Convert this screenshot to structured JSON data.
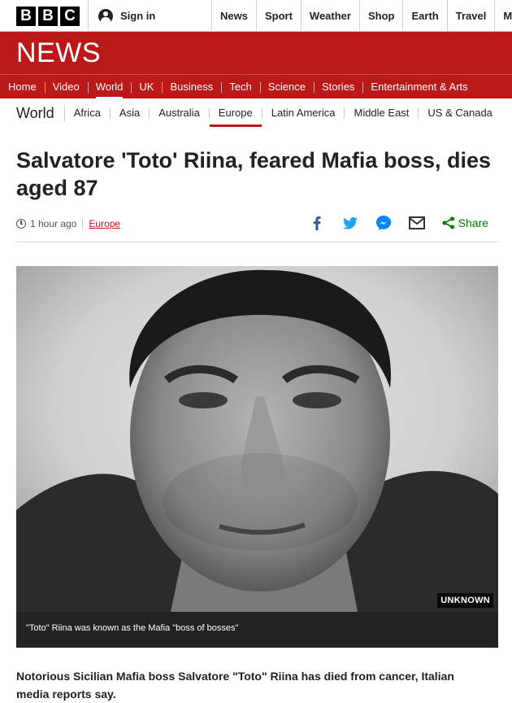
{
  "brand": {
    "letters": [
      "B",
      "B",
      "C"
    ]
  },
  "account": {
    "signin_label": "Sign in"
  },
  "topnav": [
    "News",
    "Sport",
    "Weather",
    "Shop",
    "Earth",
    "Travel",
    "Mo"
  ],
  "banner": {
    "title": "NEWS",
    "color": "#bb1919"
  },
  "section_nav": {
    "items": [
      "Home",
      "Video",
      "World",
      "UK",
      "Business",
      "Tech",
      "Science",
      "Stories",
      "Entertainment & Arts"
    ],
    "active": "World"
  },
  "sub_nav": {
    "title": "World",
    "items": [
      "Africa",
      "Asia",
      "Australia",
      "Europe",
      "Latin America",
      "Middle East",
      "US & Canada"
    ],
    "active": "Europe"
  },
  "article": {
    "headline": "Salvatore 'Toto' Riina, feared Mafia boss, dies aged 87",
    "timestamp": "1 hour ago",
    "category": "Europe",
    "share_label": "Share",
    "share_icons": [
      "facebook-icon",
      "twitter-icon",
      "messenger-icon",
      "email-icon",
      "share-icon"
    ],
    "image": {
      "credit": "UNKNOWN",
      "caption": "\"Toto\" Riina was known as the Mafia \"boss of bosses\""
    },
    "intro": "Notorious Sicilian Mafia boss Salvatore \"Toto\" Riina has died from cancer, Italian media reports say."
  },
  "colors": {
    "accent": "#bb1919",
    "share_green": "#007f00",
    "facebook": "#3b5998",
    "twitter": "#1da1f2",
    "messenger": "#0084ff"
  }
}
